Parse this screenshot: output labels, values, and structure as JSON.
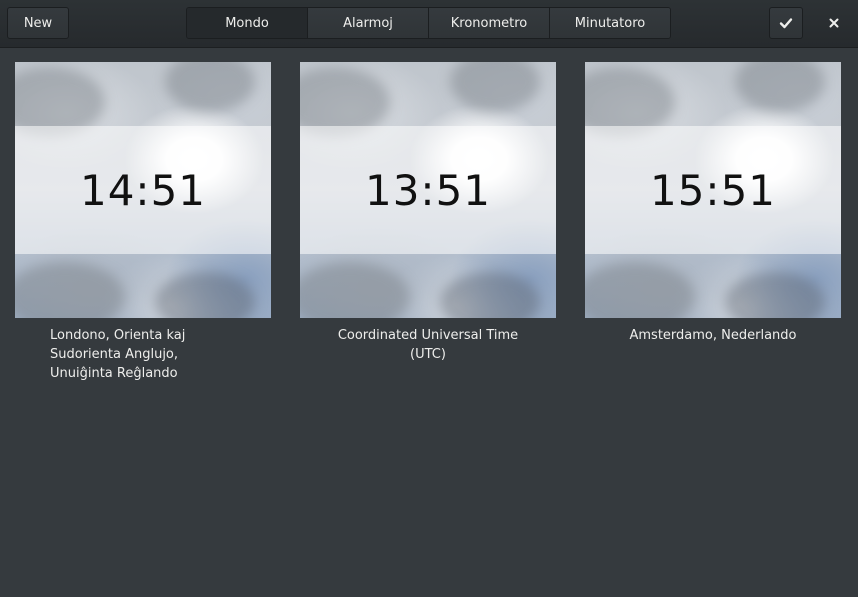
{
  "header": {
    "new_label": "New",
    "tabs": [
      {
        "label": "Mondo",
        "active": true
      },
      {
        "label": "Alarmoj",
        "active": false
      },
      {
        "label": "Kronometro",
        "active": false
      },
      {
        "label": "Minutatoro",
        "active": false
      }
    ],
    "check_icon": "✔",
    "close_icon": "✕"
  },
  "clocks": [
    {
      "time": "14:51",
      "location": "Londono, Orienta kaj Sudorienta Anglujo, Unuiĝinta Reĝlando"
    },
    {
      "time": "13:51",
      "location": "Coordinated Universal Time (UTC)"
    },
    {
      "time": "15:51",
      "location": "Amsterdamo, Nederlando"
    }
  ],
  "colors": {
    "background": "#353a3e",
    "headerbar": "#2a2e31",
    "text": "#eeeeec",
    "clock_text": "#111111"
  }
}
